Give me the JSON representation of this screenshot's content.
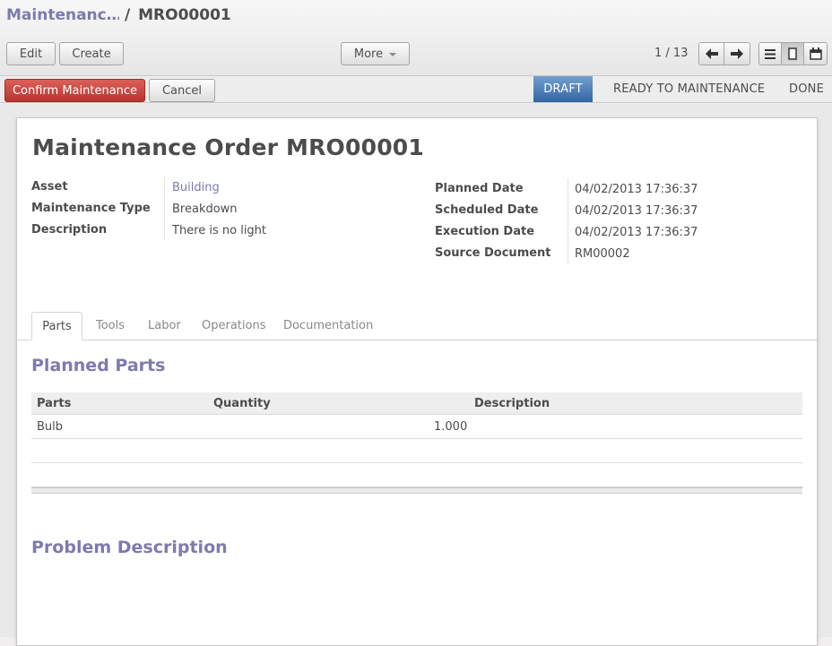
{
  "breadcrumb": {
    "parent": "Maintenanc…",
    "separator": "/",
    "current": "MRO00001"
  },
  "toolbar": {
    "edit_label": "Edit",
    "create_label": "Create",
    "more_label": "More"
  },
  "pager": {
    "value": "1 / 13"
  },
  "actions": {
    "confirm_label": "Confirm Maintenance",
    "cancel_label": "Cancel"
  },
  "statusbar": {
    "stages": [
      "DRAFT",
      "READY TO MAINTENANCE",
      "DONE"
    ],
    "active": "DRAFT"
  },
  "form": {
    "title": "Maintenance Order MRO00001",
    "left_fields": [
      {
        "label": "Asset",
        "value": "Building"
      },
      {
        "label": "Maintenance Type",
        "value": "Breakdown"
      },
      {
        "label": "Description",
        "value": "There is no light"
      }
    ],
    "right_fields": [
      {
        "label": "Planned Date",
        "value": "04/02/2013 17:36:37"
      },
      {
        "label": "Scheduled Date",
        "value": "04/02/2013 17:36:37"
      },
      {
        "label": "Execution Date",
        "value": "04/02/2013 17:36:37"
      },
      {
        "label": "Source Document",
        "value": "RM00002"
      }
    ]
  },
  "tabs": [
    "Parts",
    "Tools",
    "Labor",
    "Operations",
    "Documentation"
  ],
  "parts": {
    "section_title": "Planned Parts",
    "columns": [
      "Parts",
      "Quantity",
      "Description"
    ],
    "rows": [
      {
        "part": "Bulb",
        "quantity": "1.000",
        "description": ""
      }
    ]
  },
  "problem": {
    "section_title": "Problem Description"
  },
  "colors": {
    "accent": "#7c7bad",
    "primary_button": "#c9302c",
    "stage_active": "#4a7bbf"
  },
  "icons": [
    "arrow-left-icon",
    "arrow-right-icon",
    "list-view-icon",
    "form-view-icon",
    "calendar-view-icon",
    "caret-down-icon"
  ]
}
